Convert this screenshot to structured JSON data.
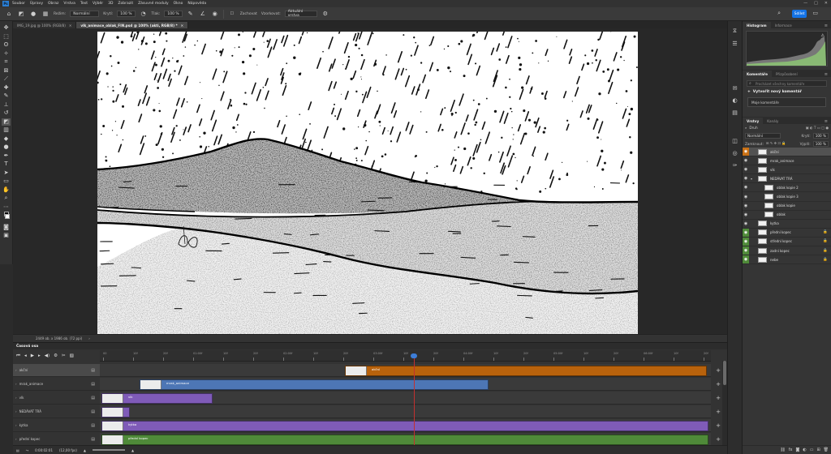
{
  "menu": [
    "Soubor",
    "Úpravy",
    "Obraz",
    "Vrstva",
    "Text",
    "Výběr",
    "3D",
    "Zobrazit",
    "Zásuvné moduly",
    "Okno",
    "Nápověda"
  ],
  "options": {
    "mode_label": "Režim:",
    "mode_value": "Normální",
    "opacity_label": "Krytí:",
    "opacity_value": "100 %",
    "flow_label": "Tlak:",
    "flow_value": "100 %",
    "erase_history": "Zachovat",
    "sample_label": "Vzorkovat:",
    "sample_value": "Aktuální vrstva",
    "share": "Sdílet"
  },
  "tabs": [
    {
      "label": "IMG_19.jpg @ 100% (RGB/8)",
      "active": false
    },
    {
      "label": "vlk_animace_oblak_FIN.psd @ 100% (akti, RGB/8) *",
      "active": true
    }
  ],
  "status": {
    "doc_size": "2449 ob. x 1986 ob. (72 ppi)"
  },
  "histogram": {
    "tabs": [
      "Histogram",
      "Informace"
    ]
  },
  "comments": {
    "tabs": [
      "Komentáře",
      "Přizpůsobení"
    ],
    "search": "Procházet všechny komentáře",
    "new": "Vytvořit nový komentář",
    "mode": "Moje komentáře"
  },
  "layers": {
    "tabs": [
      "Vrstvy",
      "Kanály"
    ],
    "filter": "Druh",
    "blend": "Normální",
    "opacity_label": "Krytí:",
    "opacity": "100 %",
    "lock_label": "Zamknout:",
    "fill_label": "Výplň:",
    "fill": "100 %",
    "items": [
      {
        "name": "akční",
        "style": "orange",
        "selected": true,
        "indent": 0,
        "lock": false,
        "fold": ""
      },
      {
        "name": "mrak_animace",
        "style": "",
        "selected": false,
        "indent": 0,
        "lock": false,
        "fold": ""
      },
      {
        "name": "vlk",
        "style": "",
        "selected": false,
        "indent": 0,
        "lock": false,
        "fold": ""
      },
      {
        "name": "NEDÁVAT TRÁ",
        "style": "",
        "selected": false,
        "indent": 0,
        "lock": false,
        "fold": "▾"
      },
      {
        "name": "oblak kopie 2",
        "style": "",
        "selected": false,
        "indent": 1,
        "lock": false,
        "fold": ""
      },
      {
        "name": "oblak kopie 3",
        "style": "",
        "selected": false,
        "indent": 1,
        "lock": false,
        "fold": ""
      },
      {
        "name": "oblak kopie",
        "style": "",
        "selected": false,
        "indent": 1,
        "lock": false,
        "fold": ""
      },
      {
        "name": "oblak",
        "style": "",
        "selected": false,
        "indent": 1,
        "lock": false,
        "fold": ""
      },
      {
        "name": "kytka",
        "style": "",
        "selected": false,
        "indent": 0,
        "lock": false,
        "fold": ""
      },
      {
        "name": "přední kopec",
        "style": "green",
        "selected": false,
        "indent": 0,
        "lock": true,
        "fold": ""
      },
      {
        "name": "střední kopec",
        "style": "green",
        "selected": false,
        "indent": 0,
        "lock": true,
        "fold": ""
      },
      {
        "name": "zadní kopec",
        "style": "green",
        "selected": false,
        "indent": 0,
        "lock": true,
        "fold": ""
      },
      {
        "name": "nebe",
        "style": "green",
        "selected": false,
        "indent": 0,
        "lock": true,
        "fold": ""
      }
    ]
  },
  "timeline": {
    "title": "Časová osa",
    "ruler": [
      "00",
      "10f",
      "20f",
      "01:00f",
      "10f",
      "20f",
      "02:00f",
      "10f",
      "20f",
      "03:00f",
      "10f",
      "20f",
      "04:00f",
      "10f",
      "20f",
      "05:00f",
      "10f",
      "20f",
      "06:00f",
      "10f",
      "20f"
    ],
    "tracks": [
      {
        "name": "akční",
        "selected": true,
        "clip_label": "akční",
        "color": "#b8620c"
      },
      {
        "name": "mrak_animace",
        "selected": false,
        "clip_label": "mrak_animace",
        "color": "#4d76b5"
      },
      {
        "name": "vlk",
        "selected": false,
        "clip_label": "vlk",
        "color": "#7f5bb8"
      },
      {
        "name": "NEDÁVAT TRÁ",
        "selected": false,
        "clip_label": "",
        "color": "#7f5bb8"
      },
      {
        "name": "kytka",
        "selected": false,
        "clip_label": "kytka",
        "color": "#7f5bb8"
      },
      {
        "name": "přední kopec",
        "selected": false,
        "clip_label": "přední kopec",
        "color": "#4f8a39"
      }
    ],
    "timecode": "0:00:02:01",
    "fps": "(12,00 fps)"
  }
}
